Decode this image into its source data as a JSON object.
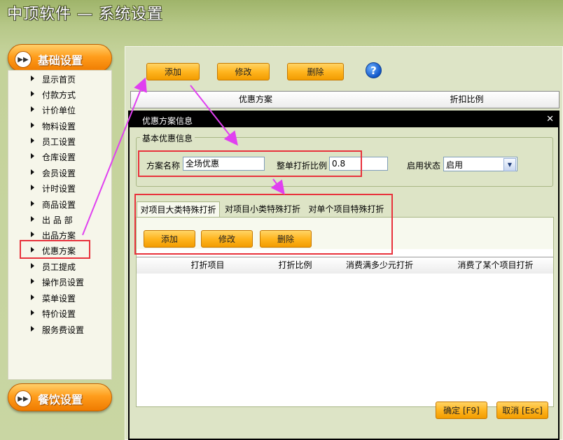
{
  "app": {
    "title": "中顶软件 — 系统设置"
  },
  "sidebar": {
    "header_label": "基础设置",
    "footer_label": "餐饮设置",
    "items": [
      {
        "label": "显示首页"
      },
      {
        "label": "付款方式"
      },
      {
        "label": "计价单位"
      },
      {
        "label": "物料设置"
      },
      {
        "label": "员工设置"
      },
      {
        "label": "仓库设置"
      },
      {
        "label": "会员设置"
      },
      {
        "label": "计时设置"
      },
      {
        "label": "商品设置"
      },
      {
        "label": "出 品 部"
      },
      {
        "label": "出品方案"
      },
      {
        "label": "优惠方案"
      },
      {
        "label": "员工提成"
      },
      {
        "label": "操作员设置"
      },
      {
        "label": "菜单设置"
      },
      {
        "label": "特价设置"
      },
      {
        "label": "服务费设置"
      }
    ],
    "selected_index": 11
  },
  "toolbar": {
    "add_label": "添加",
    "edit_label": "修改",
    "delete_label": "删除"
  },
  "background_grid": {
    "columns": [
      "优惠方案",
      "折扣比例"
    ]
  },
  "dialog": {
    "title": "优惠方案信息",
    "basic_group_title": "基本优惠信息",
    "fields": {
      "name_label": "方案名称",
      "name_value": "全场优惠",
      "ratio_label": "整单打折比例",
      "ratio_value": "0.8",
      "status_label": "启用状态",
      "status_value": "启用"
    },
    "tabs": [
      {
        "label": "对项目大类特殊打折"
      },
      {
        "label": "对项目小类特殊打折"
      },
      {
        "label": "对单个项目特殊打折"
      }
    ],
    "active_tab": 0,
    "tab_toolbar": {
      "add_label": "添加",
      "edit_label": "修改",
      "delete_label": "删除"
    },
    "grid_columns": [
      "打折项目",
      "打折比例",
      "消费满多少元打折",
      "消费了某个项目打折"
    ],
    "ok_label": "确定 [F9]",
    "cancel_label": "取消 [Esc]"
  },
  "colors": {
    "annotation_red": "#e8323c",
    "annotation_arrow": "#e040f0",
    "button_orange": "#ffb51f"
  },
  "icons": {
    "help": "question-circle-icon",
    "close": "close-icon",
    "dropdown": "chevron-down-icon",
    "nav": "triangle-right-icon"
  }
}
